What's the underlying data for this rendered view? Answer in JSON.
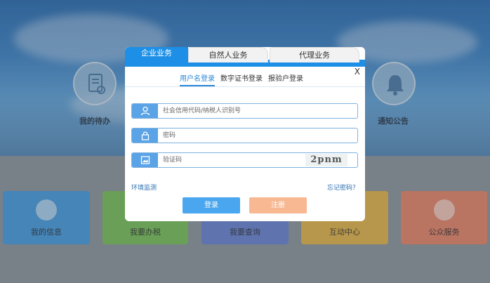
{
  "background": {
    "shortcuts": [
      {
        "label": "我的待办",
        "icon": "document-icon"
      },
      {
        "label": "通知公告",
        "icon": "bell-icon"
      }
    ],
    "tiles": [
      {
        "label": "我的信息",
        "color": "#4a9ee0"
      },
      {
        "label": "我要办税",
        "color": "#7cc35a"
      },
      {
        "label": "我要查询",
        "color": "#6d87d4"
      },
      {
        "label": "互动中心",
        "color": "#e6b84a"
      },
      {
        "label": "公众服务",
        "color": "#e9876a"
      }
    ]
  },
  "login": {
    "tabs": [
      "企业业务",
      "自然人业务",
      "代理业务"
    ],
    "close": "X",
    "subtabs": [
      "用户名登录",
      "数字证书登录",
      "报验户登录"
    ],
    "fields": {
      "username_placeholder": "社会信用代码/纳税人识别号",
      "password_placeholder": "密码",
      "captcha_placeholder": "验证码",
      "captcha_text": "2pnm"
    },
    "links": {
      "env_check": "环境监测",
      "forgot": "忘记密码？"
    },
    "buttons": {
      "login": "登录",
      "register": "注册"
    }
  }
}
